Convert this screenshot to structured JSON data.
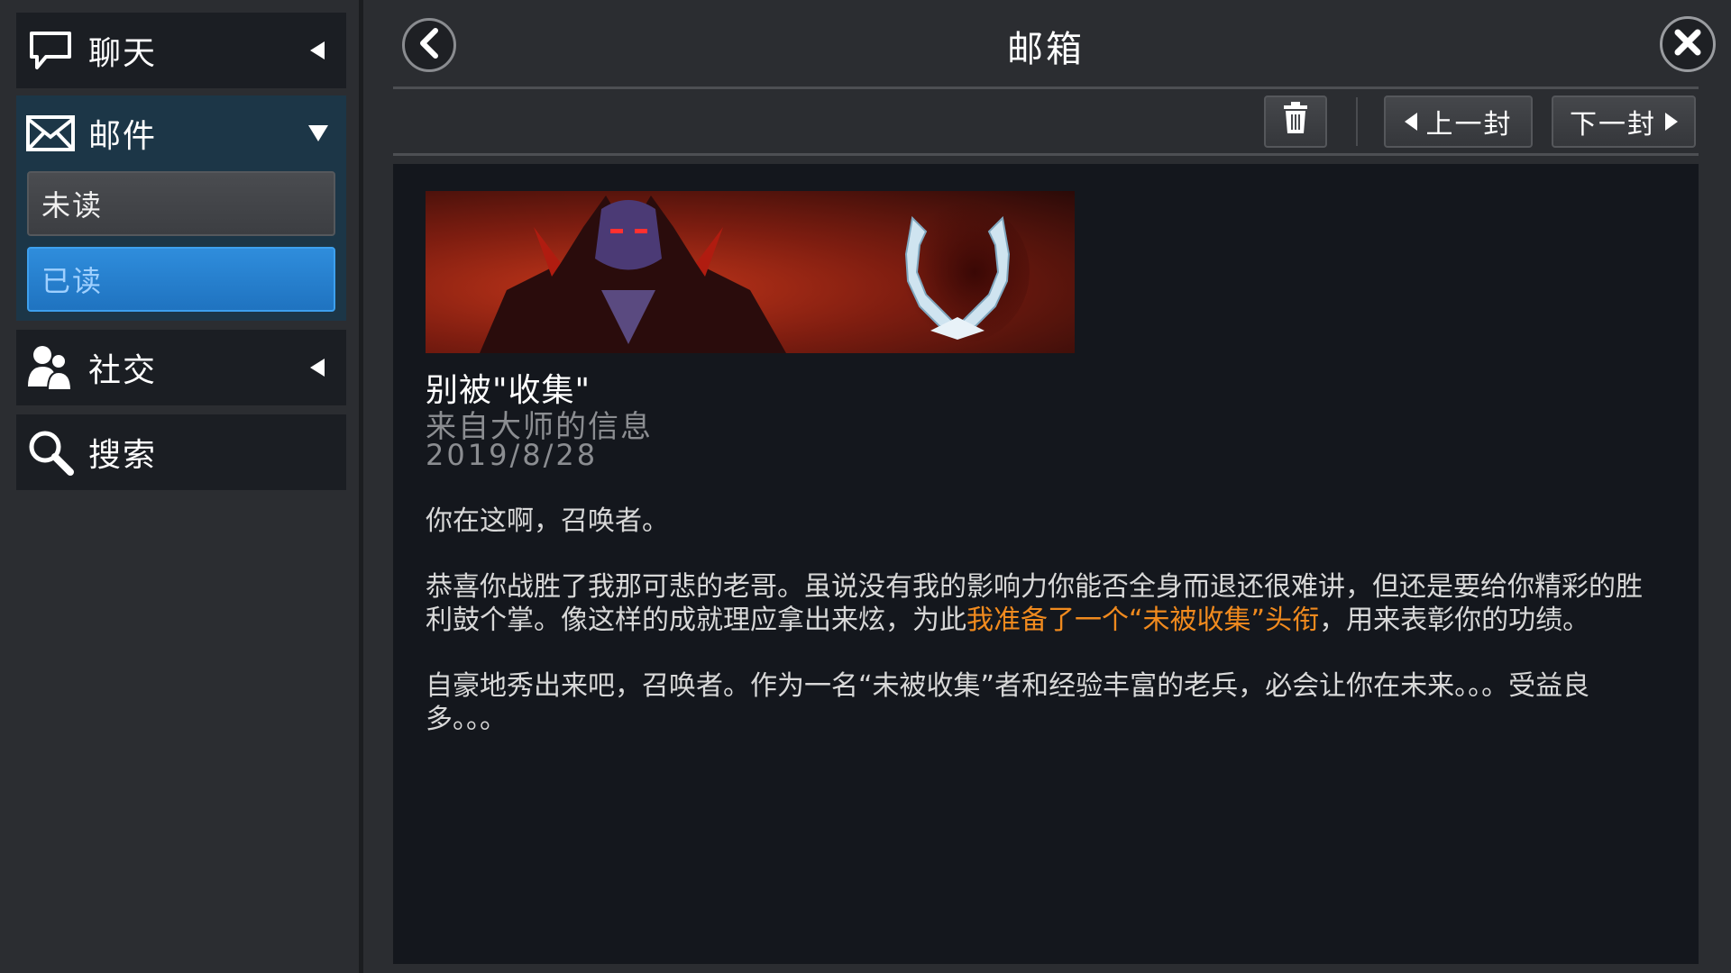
{
  "sidebar": {
    "chat": {
      "label": "聊天",
      "icon": "chat-bubble-icon"
    },
    "mail": {
      "label": "邮件",
      "icon": "envelope-icon",
      "sub_items": [
        {
          "label": "未读",
          "state": "default"
        },
        {
          "label": "已读",
          "state": "selected"
        }
      ]
    },
    "social": {
      "label": "社交",
      "icon": "people-icon"
    },
    "search": {
      "label": "搜索",
      "icon": "search-icon"
    }
  },
  "header": {
    "title": "邮箱"
  },
  "toolbar": {
    "delete_icon": "trash-icon",
    "prev_label": "上一封",
    "next_label": "下一封"
  },
  "mail": {
    "subject": "别被\"收集\"",
    "sender": "来自大师的信息",
    "date": "2019/8/28",
    "body": {
      "p1": "你在这啊，召唤者。",
      "p2_before": "恭喜你战胜了我那可悲的老哥。虽说没有我的影响力你能否全身而退还很难讲，但还是要给你精彩的胜利鼓个掌。像这样的成就理应拿出来炫，为此",
      "p2_highlight": "我准备了一个“未被收集”头衔",
      "p2_after": "，用来表彰你的功绩。",
      "p3": "自豪地秀出来吧，召唤者。作为一名“未被收集”者和经验丰富的老兵，必会让你在未来。。。受益良多。。。"
    }
  },
  "colors": {
    "selected_blue": "#2382d4",
    "highlight_orange": "#f08a1e",
    "mail_group_bg": "#1c3647"
  }
}
